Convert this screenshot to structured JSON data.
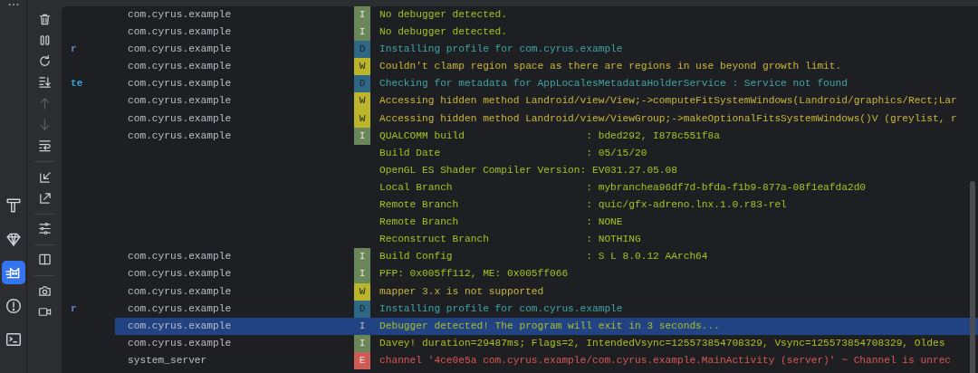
{
  "activity_bar": [
    {
      "kind": "more",
      "selected": false
    },
    {
      "kind": "build",
      "selected": false
    },
    {
      "kind": "gem",
      "selected": false
    },
    {
      "kind": "cat",
      "selected": true
    },
    {
      "kind": "problems",
      "selected": false
    },
    {
      "kind": "terminal",
      "selected": false
    }
  ],
  "toolbar_groups": [
    [
      {
        "kind": "clear",
        "disabled": false
      },
      {
        "kind": "pause",
        "disabled": false
      },
      {
        "kind": "restart",
        "disabled": false
      },
      {
        "kind": "scroll-end",
        "disabled": false
      },
      {
        "kind": "up",
        "disabled": true
      },
      {
        "kind": "down",
        "disabled": true
      },
      {
        "kind": "wrap",
        "disabled": false
      }
    ],
    [
      {
        "kind": "import",
        "disabled": false
      },
      {
        "kind": "export",
        "disabled": false
      }
    ],
    [
      {
        "kind": "sliders",
        "disabled": false
      }
    ],
    [
      {
        "kind": "split",
        "disabled": false
      }
    ],
    [
      {
        "kind": "camera",
        "disabled": false
      },
      {
        "kind": "video",
        "disabled": false
      }
    ]
  ],
  "log_rows": [
    {
      "kind": "entry",
      "tag": "",
      "package": "com.cyrus.example",
      "level": "I",
      "message": "No debugger detected.",
      "selected": false
    },
    {
      "kind": "entry",
      "tag": "",
      "package": "com.cyrus.example",
      "level": "I",
      "message": "No debugger detected.",
      "selected": false
    },
    {
      "kind": "entry",
      "tag": {
        "text": "r",
        "color": "#5c8ad0"
      },
      "package": "com.cyrus.example",
      "level": "D",
      "message": "Installing profile for com.cyrus.example",
      "selected": false
    },
    {
      "kind": "entry",
      "tag": "",
      "package": "com.cyrus.example",
      "level": "W",
      "message": "Couldn't clamp region space as there are regions in use beyond growth limit.",
      "selected": false
    },
    {
      "kind": "entry",
      "tag": {
        "text": "te",
        "color": "#3aa6e0"
      },
      "package": "com.cyrus.example",
      "level": "D",
      "message": "Checking for metadata for AppLocalesMetadataHolderService : Service not found",
      "selected": false
    },
    {
      "kind": "entry",
      "tag": "",
      "package": "com.cyrus.example",
      "level": "W",
      "message": "Accessing hidden method Landroid/view/View;->computeFitSystemWindows(Landroid/graphics/Rect;Lar",
      "selected": false
    },
    {
      "kind": "entry",
      "tag": "",
      "package": "com.cyrus.example",
      "level": "W",
      "message": "Accessing hidden method Landroid/view/ViewGroup;->makeOptionalFitsSystemWindows()V (greylist, r",
      "selected": false
    },
    {
      "kind": "entry",
      "tag": "",
      "package": "com.cyrus.example",
      "level": "I",
      "message": "QUALCOMM build                    : bded292, I878c551f8a",
      "selected": false
    },
    {
      "kind": "continuation",
      "message": "Build Date                        : 05/15/20"
    },
    {
      "kind": "continuation",
      "message": "OpenGL ES Shader Compiler Version: EV031.27.05.08"
    },
    {
      "kind": "continuation",
      "message": "Local Branch                      : mybranchea96df7d-bfda-f1b9-877a-08f1eafda2d0"
    },
    {
      "kind": "continuation",
      "message": "Remote Branch                     : quic/gfx-adreno.lnx.1.0.r83-rel"
    },
    {
      "kind": "continuation",
      "message": "Remote Branch                     : NONE"
    },
    {
      "kind": "continuation",
      "message": "Reconstruct Branch                : NOTHING"
    },
    {
      "kind": "entry",
      "tag": "",
      "package": "com.cyrus.example",
      "level": "I",
      "message": "Build Config                      : S L 8.0.12 AArch64",
      "selected": false
    },
    {
      "kind": "entry",
      "tag": "",
      "package": "com.cyrus.example",
      "level": "I",
      "message": "PFP: 0x005ff112, ME: 0x005ff066",
      "selected": false
    },
    {
      "kind": "entry",
      "tag": "",
      "package": "com.cyrus.example",
      "level": "W",
      "message": "mapper 3.x is not supported",
      "selected": false
    },
    {
      "kind": "entry",
      "tag": {
        "text": "r",
        "color": "#5c8ad0"
      },
      "package": "com.cyrus.example",
      "level": "D",
      "message": "Installing profile for com.cyrus.example",
      "selected": false
    },
    {
      "kind": "entry",
      "tag": "",
      "package": "com.cyrus.example",
      "level": "I",
      "message": "Debugger detected! The program will exit in 3 seconds...",
      "selected": true
    },
    {
      "kind": "entry",
      "tag": "",
      "package": "com.cyrus.example",
      "level": "I",
      "message": "Davey! duration=29487ms; Flags=2, IntendedVsync=125573854708329, Vsync=125573854708329, Oldes",
      "selected": false
    },
    {
      "kind": "entry",
      "tag": "",
      "package": "system_server",
      "level": "E",
      "message": "channel '4ce0e5a com.cyrus.example/com.cyrus.example.MainActivity (server)' ~ Channel is unrec",
      "selected": false
    }
  ]
}
